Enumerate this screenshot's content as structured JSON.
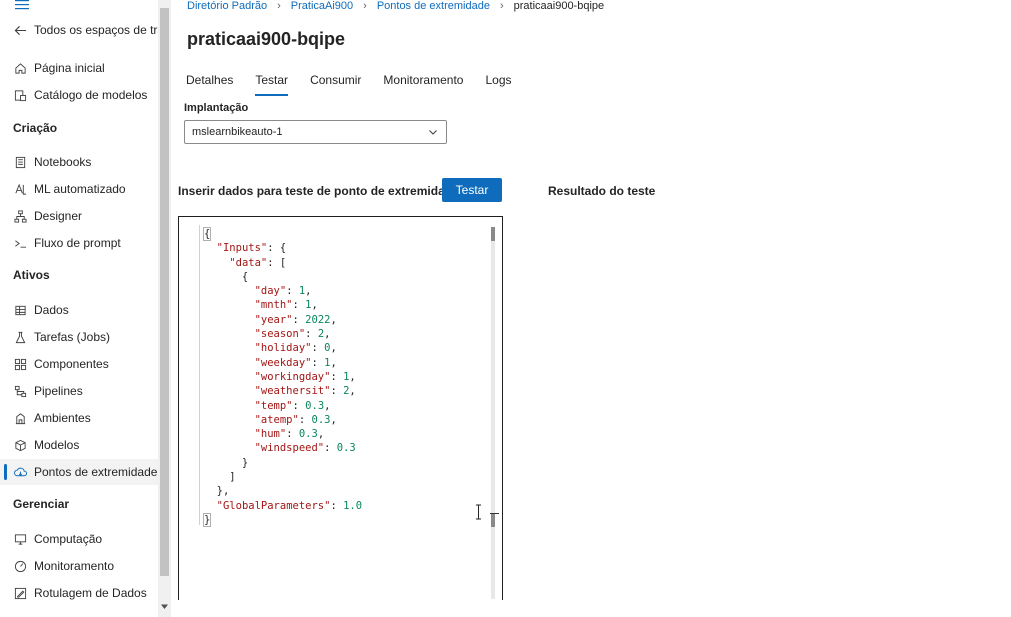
{
  "sidebar": {
    "back_label": "Todos os espaços de traba",
    "items_top": [
      {
        "label": "Página inicial",
        "icon": "home-icon"
      },
      {
        "label": "Catálogo de modelos",
        "icon": "catalog-icon"
      }
    ],
    "sections": [
      {
        "title": "Criação",
        "items": [
          {
            "label": "Notebooks",
            "icon": "notebook-icon"
          },
          {
            "label": "ML automatizado",
            "icon": "automl-icon"
          },
          {
            "label": "Designer",
            "icon": "designer-icon"
          },
          {
            "label": "Fluxo de prompt",
            "icon": "prompt-flow-icon"
          }
        ]
      },
      {
        "title": "Ativos",
        "items": [
          {
            "label": "Dados",
            "icon": "data-icon"
          },
          {
            "label": "Tarefas (Jobs)",
            "icon": "jobs-icon"
          },
          {
            "label": "Componentes",
            "icon": "components-icon"
          },
          {
            "label": "Pipelines",
            "icon": "pipelines-icon"
          },
          {
            "label": "Ambientes",
            "icon": "environments-icon"
          },
          {
            "label": "Modelos",
            "icon": "models-icon"
          },
          {
            "label": "Pontos de extremidade",
            "icon": "endpoints-icon",
            "active": true
          }
        ]
      },
      {
        "title": "Gerenciar",
        "items": [
          {
            "label": "Computação",
            "icon": "compute-icon"
          },
          {
            "label": "Monitoramento",
            "icon": "monitoring-icon"
          },
          {
            "label": "Rotulagem de Dados",
            "icon": "labeling-icon"
          }
        ]
      }
    ]
  },
  "breadcrumb": {
    "items": [
      "Diretório Padrão",
      "PraticaAi900",
      "Pontos de extremidade"
    ],
    "current": "praticaai900-bqipe"
  },
  "page_title": "praticaai900-bqipe",
  "tabs": [
    {
      "label": "Detalhes"
    },
    {
      "label": "Testar",
      "active": true
    },
    {
      "label": "Consumir"
    },
    {
      "label": "Monitoramento"
    },
    {
      "label": "Logs"
    }
  ],
  "deployment": {
    "label": "Implantação",
    "selected": "mslearnbikeauto-1"
  },
  "test": {
    "input_heading": "Inserir dados para teste de ponto de extremidade",
    "button_label": "Testar",
    "result_heading": "Resultado do teste"
  },
  "editor": {
    "inputs_key": "\"Inputs\"",
    "data_key": "\"data\"",
    "fields": [
      {
        "key": "\"day\"",
        "value": "1"
      },
      {
        "key": "\"mnth\"",
        "value": "1"
      },
      {
        "key": "\"year\"",
        "value": "2022"
      },
      {
        "key": "\"season\"",
        "value": "2"
      },
      {
        "key": "\"holiday\"",
        "value": "0"
      },
      {
        "key": "\"weekday\"",
        "value": "1"
      },
      {
        "key": "\"workingday\"",
        "value": "1"
      },
      {
        "key": "\"weathersit\"",
        "value": "2"
      },
      {
        "key": "\"temp\"",
        "value": "0.3"
      },
      {
        "key": "\"atemp\"",
        "value": "0.3"
      },
      {
        "key": "\"hum\"",
        "value": "0.3"
      },
      {
        "key": "\"windspeed\"",
        "value": "0.3"
      }
    ],
    "global_key": "\"GlobalParameters\"",
    "global_value": "1.0"
  },
  "colors": {
    "accent": "#0f6cbd",
    "json_key": "#a31515",
    "json_number": "#098658"
  }
}
